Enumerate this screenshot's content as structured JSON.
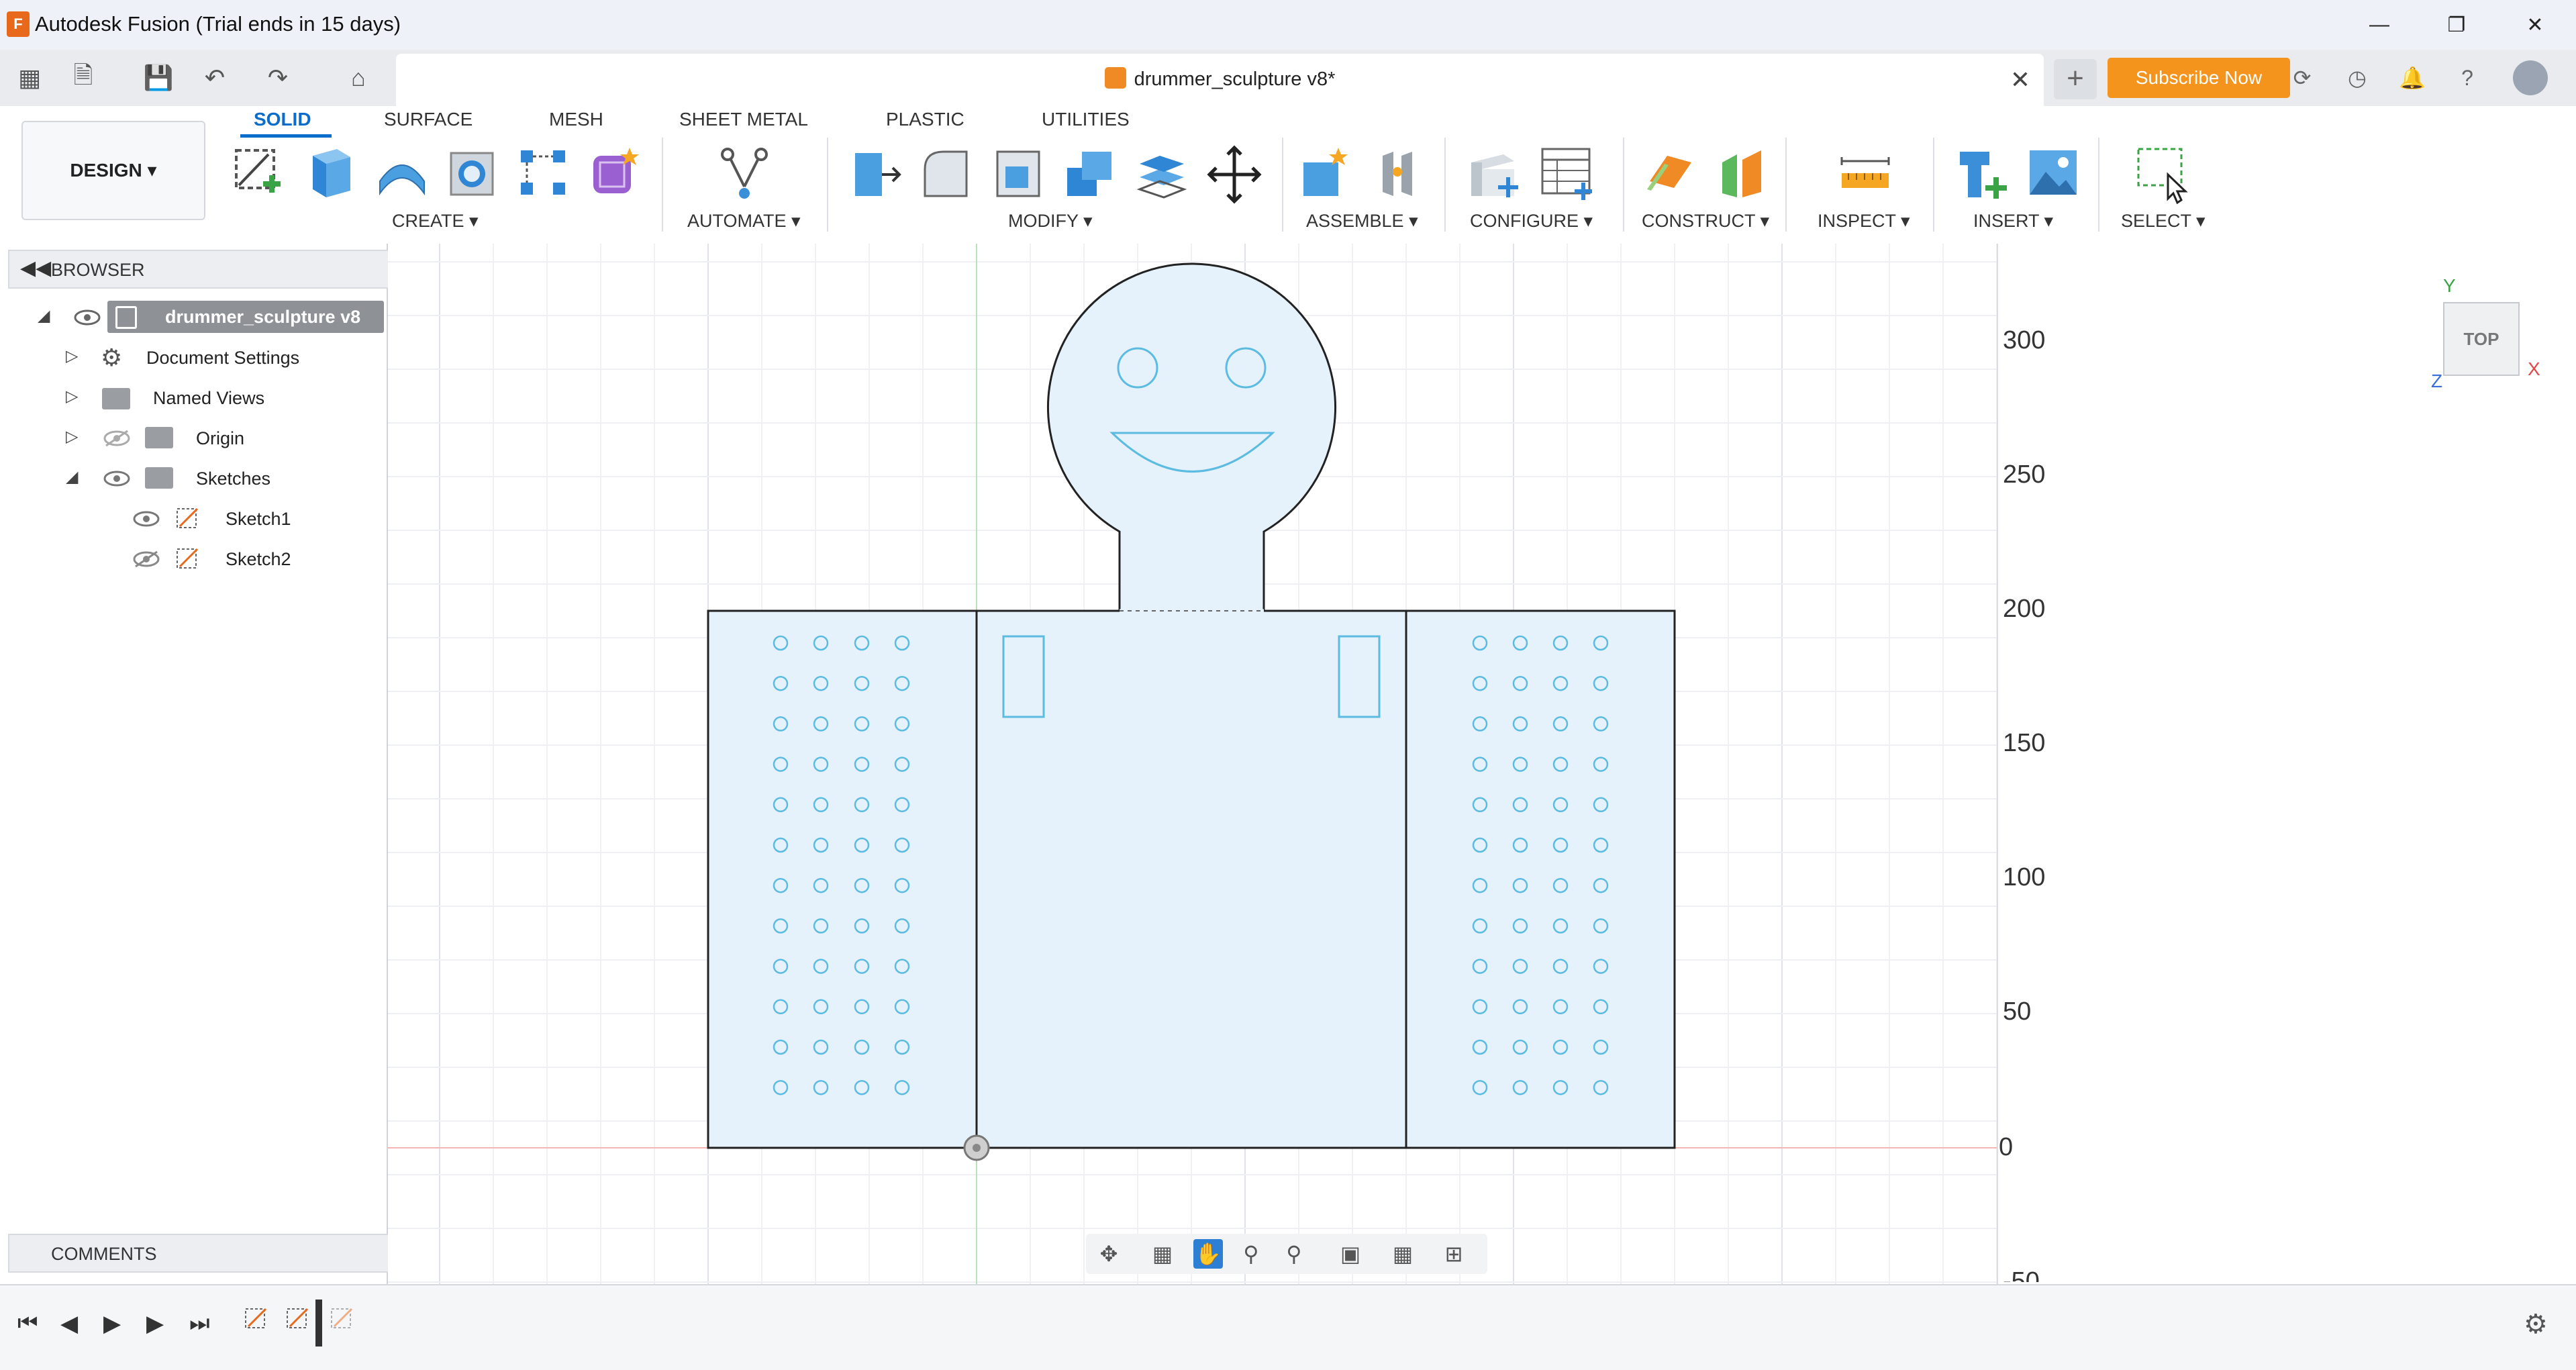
{
  "window": {
    "app_logo": "F",
    "title": "Autodesk Fusion (Trial ends in 15 days)",
    "controls": [
      "minimize",
      "restore",
      "close"
    ]
  },
  "header": {
    "document_tab": "drummer_sculpture v8*",
    "subscribe_label": "Subscribe Now",
    "icons": [
      "apps-grid-icon",
      "file-icon",
      "save-icon",
      "undo-icon",
      "redo-icon",
      "home-icon",
      "job-status-icon",
      "history-icon",
      "notifications-icon",
      "help-icon",
      "user-avatar"
    ]
  },
  "workspace": {
    "label": "DESIGN"
  },
  "ribbon": {
    "tabs": [
      "SOLID",
      "SURFACE",
      "MESH",
      "SHEET METAL",
      "PLASTIC",
      "UTILITIES"
    ],
    "active_tab": "SOLID",
    "groups": [
      "CREATE",
      "AUTOMATE",
      "MODIFY",
      "ASSEMBLE",
      "CONFIGURE",
      "CONSTRUCT",
      "INSPECT",
      "INSERT",
      "SELECT"
    ]
  },
  "browser": {
    "title": "BROWSER",
    "root": "drummer_sculpture v8",
    "items": [
      {
        "label": "Document Settings"
      },
      {
        "label": "Named Views"
      },
      {
        "label": "Origin"
      },
      {
        "label": "Sketches"
      },
      {
        "label": "Sketch1"
      },
      {
        "label": "Sketch2"
      }
    ]
  },
  "comments": {
    "title": "COMMENTS"
  },
  "canvas": {
    "y_axis_ticks": [
      "300",
      "250",
      "200",
      "150",
      "100",
      "50",
      "0",
      "-50"
    ]
  },
  "viewcube": {
    "face": "TOP",
    "axes": [
      "Y",
      "X",
      "Z"
    ]
  },
  "colors": {
    "accent": "#0a6ccb",
    "subscribe": "#f5941d",
    "sketch_fill": "#e6f2fb",
    "sketch_hole": "#5bbbe0",
    "axis_red": "#f3b5b5",
    "axis_green": "#b8e3b8"
  }
}
